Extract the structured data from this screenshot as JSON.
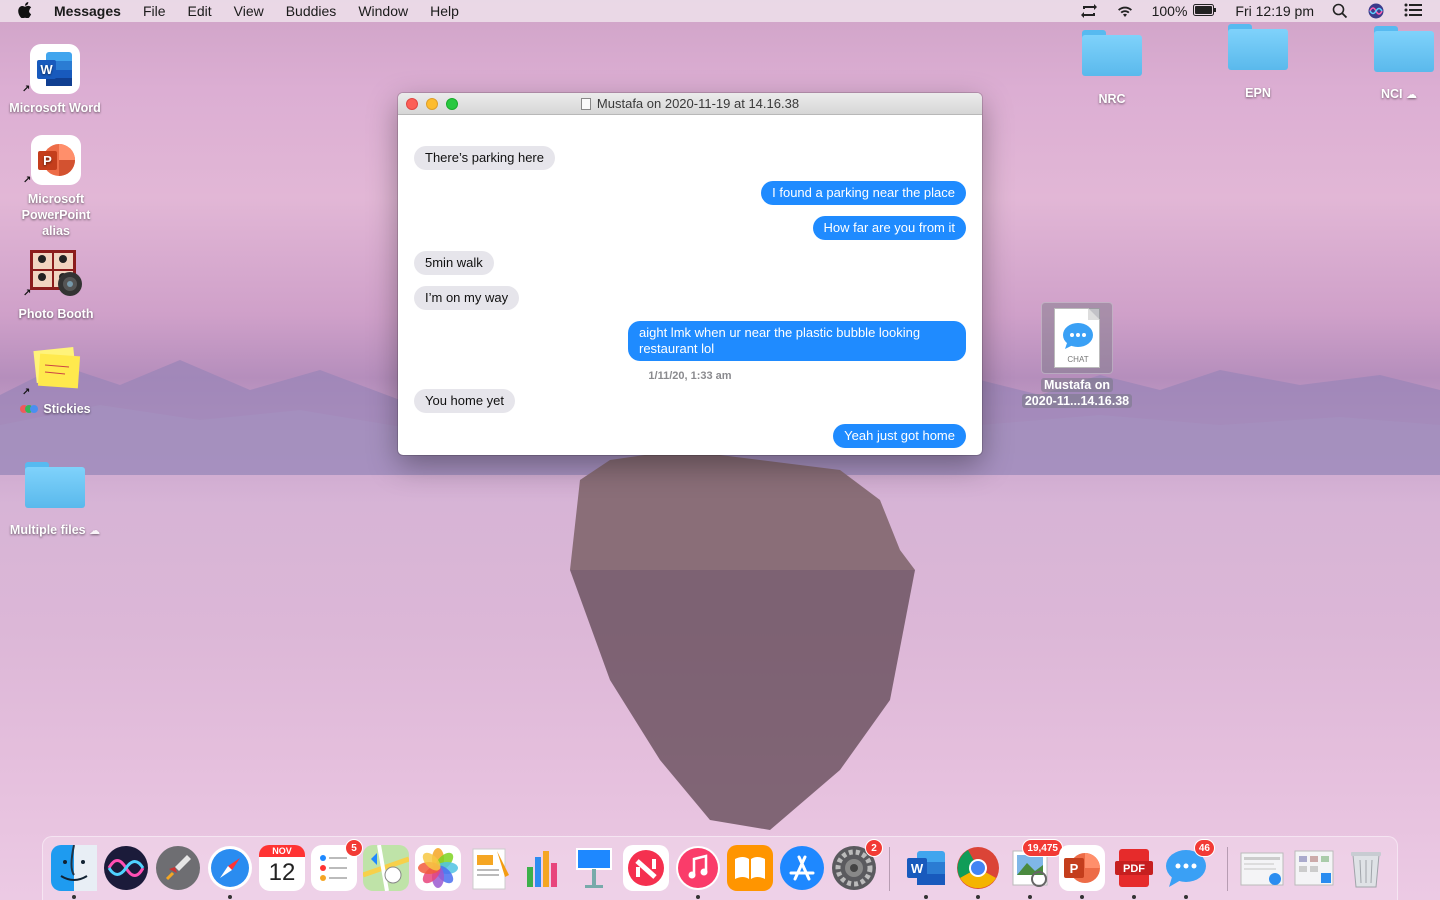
{
  "menubar": {
    "app_name": "Messages",
    "items": [
      "File",
      "Edit",
      "View",
      "Buddies",
      "Window",
      "Help"
    ],
    "battery": "100%",
    "clock": "Fri 12:19 pm"
  },
  "desktop": {
    "icons": [
      {
        "label": "Microsoft Word"
      },
      {
        "label": "Microsoft PowerPoint alias"
      },
      {
        "label": "Photo Booth"
      },
      {
        "label": "Stickies"
      },
      {
        "label": "Multiple files"
      }
    ],
    "folders": [
      {
        "label": "NRC"
      },
      {
        "label": "EPN"
      },
      {
        "label": "NCI"
      }
    ],
    "chat_file": {
      "tag": "CHAT",
      "label_line1": "Mustafa on",
      "label_line2": "2020-11...14.16.38"
    }
  },
  "window": {
    "title": "Mustafa on 2020-11-19 at 14.16.38",
    "messages": [
      {
        "dir": "in",
        "text": "There’s parking here"
      },
      {
        "dir": "out",
        "text": "I found a parking near the place"
      },
      {
        "dir": "out",
        "text": "How far are you from it"
      },
      {
        "dir": "in",
        "text": "5min walk"
      },
      {
        "dir": "in",
        "text": "I’m on my way"
      },
      {
        "dir": "out",
        "text": "aight lmk when ur near the plastic bubble looking restaurant lol"
      },
      {
        "dir": "in",
        "text": "You home yet"
      },
      {
        "dir": "out",
        "text": "Yeah just got home"
      }
    ],
    "timestamp": "1/11/20, 1:33 am"
  },
  "dock": {
    "calendar_month": "NOV",
    "calendar_day": "12",
    "badges": {
      "reminders": "5",
      "system_prefs": "2",
      "preview": "19,475",
      "messages": "46"
    },
    "colors": {
      "messages_blue": "#1f8bff",
      "badge_red": "#f23a35"
    }
  }
}
